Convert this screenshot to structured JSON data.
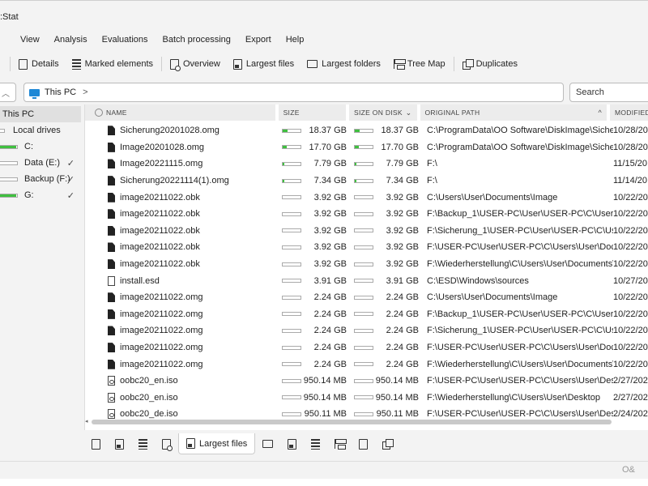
{
  "window": {
    "title": ":Stat"
  },
  "menu": [
    "View",
    "Analysis",
    "Evaluations",
    "Batch processing",
    "Export",
    "Help"
  ],
  "toolbar": {
    "details": "Details",
    "marked": "Marked elements",
    "overview": "Overview",
    "largest_files": "Largest files",
    "largest_folders": "Largest folders",
    "tree_map": "Tree Map",
    "duplicates": "Duplicates"
  },
  "address": {
    "location": "This PC",
    "separator": ">"
  },
  "search": {
    "placeholder": "Search"
  },
  "sidebar": {
    "root": "This PC",
    "local_drives": "Local drives",
    "drives": [
      {
        "label": "C:",
        "fill": 0.95,
        "checked": false
      },
      {
        "label": "Data (E:)",
        "fill": 0.05,
        "checked": true
      },
      {
        "label": "Backup (F:)",
        "fill": 0.05,
        "checked": true
      },
      {
        "label": "G:",
        "fill": 0.95,
        "checked": true
      }
    ]
  },
  "table": {
    "headers": {
      "name": "NAME",
      "size": "SIZE",
      "size_on_disk": "SIZE ON DISK",
      "path": "ORIGINAL PATH",
      "modified": "MODIFIED"
    },
    "rows": [
      {
        "icon": "solid",
        "name": "Sicherung20201028.omg",
        "size": "18.37 GB",
        "disk": "18.37 GB",
        "path": "C:\\ProgramData\\OO Software\\DiskImage\\Sicher...",
        "mod": "10/28/20",
        "fill": 0.25
      },
      {
        "icon": "solid",
        "name": "Image20201028.omg",
        "size": "17.70 GB",
        "disk": "17.70 GB",
        "path": "C:\\ProgramData\\OO Software\\DiskImage\\Sicher...",
        "mod": "10/28/20",
        "fill": 0.24
      },
      {
        "icon": "solid",
        "name": "Image20221115.omg",
        "size": "7.79 GB",
        "disk": "7.79 GB",
        "path": "F:\\",
        "mod": "11/15/20",
        "fill": 0.1
      },
      {
        "icon": "solid",
        "name": "Sicherung20221114(1).omg",
        "size": "7.34 GB",
        "disk": "7.34 GB",
        "path": "F:\\",
        "mod": "11/14/20",
        "fill": 0.1
      },
      {
        "icon": "solid",
        "name": "image20211022.obk",
        "size": "3.92 GB",
        "disk": "3.92 GB",
        "path": "C:\\Users\\User\\Documents\\Image",
        "mod": "10/22/20",
        "fill": 0
      },
      {
        "icon": "solid",
        "name": "image20211022.obk",
        "size": "3.92 GB",
        "disk": "3.92 GB",
        "path": "F:\\Backup_1\\USER-PC\\User\\USER-PC\\C\\Users\\U...",
        "mod": "10/22/20",
        "fill": 0
      },
      {
        "icon": "solid",
        "name": "image20211022.obk",
        "size": "3.92 GB",
        "disk": "3.92 GB",
        "path": "F:\\Sicherung_1\\USER-PC\\User\\USER-PC\\C\\Users...",
        "mod": "10/22/20",
        "fill": 0
      },
      {
        "icon": "solid",
        "name": "image20211022.obk",
        "size": "3.92 GB",
        "disk": "3.92 GB",
        "path": "F:\\USER-PC\\User\\USER-PC\\C\\Users\\User\\Docu...",
        "mod": "10/22/20",
        "fill": 0
      },
      {
        "icon": "solid",
        "name": "image20211022.obk",
        "size": "3.92 GB",
        "disk": "3.92 GB",
        "path": "F:\\Wiederherstellung\\C\\Users\\User\\Documents\\...",
        "mod": "10/22/20",
        "fill": 0
      },
      {
        "icon": "outline",
        "name": "install.esd",
        "size": "3.91 GB",
        "disk": "3.91 GB",
        "path": "C:\\ESD\\Windows\\sources",
        "mod": "10/27/20",
        "fill": 0
      },
      {
        "icon": "solid",
        "name": "image20211022.omg",
        "size": "2.24 GB",
        "disk": "2.24 GB",
        "path": "C:\\Users\\User\\Documents\\Image",
        "mod": "10/22/20",
        "fill": 0
      },
      {
        "icon": "solid",
        "name": "image20211022.omg",
        "size": "2.24 GB",
        "disk": "2.24 GB",
        "path": "F:\\Backup_1\\USER-PC\\User\\USER-PC\\C\\Users\\U...",
        "mod": "10/22/20",
        "fill": 0
      },
      {
        "icon": "solid",
        "name": "image20211022.omg",
        "size": "2.24 GB",
        "disk": "2.24 GB",
        "path": "F:\\Sicherung_1\\USER-PC\\User\\USER-PC\\C\\Users...",
        "mod": "10/22/20",
        "fill": 0
      },
      {
        "icon": "solid",
        "name": "image20211022.omg",
        "size": "2.24 GB",
        "disk": "2.24 GB",
        "path": "F:\\USER-PC\\User\\USER-PC\\C\\Users\\User\\Docu...",
        "mod": "10/22/20",
        "fill": 0
      },
      {
        "icon": "solid",
        "name": "image20211022.omg",
        "size": "2.24 GB",
        "disk": "2.24 GB",
        "path": "F:\\Wiederherstellung\\C\\Users\\User\\Documents\\...",
        "mod": "10/22/20",
        "fill": 0
      },
      {
        "icon": "iso",
        "name": "oobc20_en.iso",
        "size": "950.14 MB",
        "disk": "950.14 MB",
        "path": "F:\\USER-PC\\User\\USER-PC\\C\\Users\\User\\Desktop",
        "mod": "2/27/202",
        "fill": 0
      },
      {
        "icon": "iso",
        "name": "oobc20_en.iso",
        "size": "950.14 MB",
        "disk": "950.14 MB",
        "path": "F:\\Wiederherstellung\\C\\Users\\User\\Desktop",
        "mod": "2/27/202",
        "fill": 0
      },
      {
        "icon": "iso",
        "name": "oobc20_de.iso",
        "size": "950.11 MB",
        "disk": "950.11 MB",
        "path": "F:\\USER-PC\\User\\USER-PC\\C\\Users\\User\\Desktop",
        "mod": "2/24/202",
        "fill": 0
      }
    ]
  },
  "bottom_tabs": {
    "active_label": "Largest files"
  },
  "status": {
    "logo": "O&"
  },
  "colors": {
    "bar_fill": "#3fbf3f",
    "accent": "#1e88d6"
  }
}
